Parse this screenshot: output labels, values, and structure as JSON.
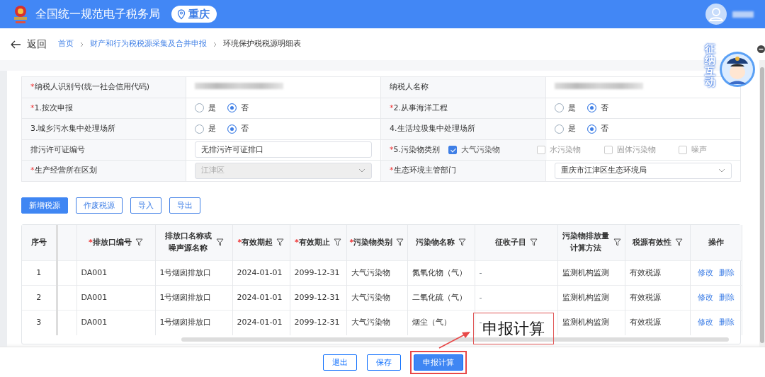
{
  "header": {
    "title": "全国统一规范电子税务局",
    "location": "重庆"
  },
  "nav": {
    "back": "返回",
    "breadcrumbs": [
      {
        "label": "首页",
        "current": false
      },
      {
        "label": "财产和行为税税源采集及合并申报",
        "current": false
      },
      {
        "label": "环境保护税税源明细表",
        "current": true
      }
    ]
  },
  "form": {
    "rows": [
      [
        {
          "kind": "blurred",
          "mark": "*",
          "label": "纳税人识别号(统一社会信用代码)"
        },
        {
          "kind": "blurred",
          "label": "纳税人名称"
        }
      ],
      [
        {
          "kind": "radio",
          "mark": "*",
          "label": "1.按次申报",
          "options": [
            {
              "label": "是",
              "selected": false
            },
            {
              "label": "否",
              "selected": true
            }
          ]
        },
        {
          "kind": "radio",
          "mark": "*",
          "label": "2.从事海洋工程",
          "options": [
            {
              "label": "是",
              "selected": false
            },
            {
              "label": "否",
              "selected": true
            }
          ]
        }
      ],
      [
        {
          "kind": "radio",
          "label": "3.城乡污水集中处理场所",
          "options": [
            {
              "label": "是",
              "selected": false
            },
            {
              "label": "否",
              "selected": true
            }
          ]
        },
        {
          "kind": "radio",
          "label": "4.生活垃圾集中处理场所",
          "options": [
            {
              "label": "是",
              "selected": false
            },
            {
              "label": "否",
              "selected": true
            }
          ]
        }
      ],
      [
        {
          "kind": "input",
          "label": "排污许可证编号",
          "value": "无排污许可证排口"
        },
        {
          "kind": "checks",
          "mark": "*",
          "label": "5.污染物类别",
          "options": [
            {
              "label": "大气污染物",
              "checked": true
            },
            {
              "label": "水污染物",
              "checked": false
            },
            {
              "label": "固体污染物",
              "checked": false
            },
            {
              "label": "噪声",
              "checked": false
            }
          ]
        }
      ],
      [
        {
          "kind": "select",
          "mark": "*",
          "label": "生产经营所在区划",
          "value": "江津区",
          "disabled": true
        },
        {
          "kind": "select",
          "mark": "*",
          "label": "生态环境主管部门",
          "value": "重庆市江津区生态环境局",
          "disabled": false
        }
      ]
    ]
  },
  "toolbar": [
    {
      "label": "新增税源",
      "primary": true
    },
    {
      "label": "作废税源",
      "primary": false
    },
    {
      "label": "导入",
      "primary": false
    },
    {
      "label": "导出",
      "primary": false
    }
  ],
  "table": {
    "columns": [
      {
        "kind": "index",
        "label": "序号",
        "filter": false
      },
      {
        "kind": "blank"
      },
      {
        "kind": "data",
        "mark": "*",
        "label": "排放口编号",
        "filter": true
      },
      {
        "kind": "data",
        "label": "排放口名称或噪声源名称",
        "filter": true
      },
      {
        "kind": "data",
        "mark": "*",
        "label": "有效期起",
        "filter": true
      },
      {
        "kind": "data",
        "mark": "*",
        "label": "有效期止",
        "filter": true
      },
      {
        "kind": "data",
        "mark": "*",
        "label": "污染物类别",
        "filter": true
      },
      {
        "kind": "data",
        "label": "污染物名称",
        "filter": true
      },
      {
        "kind": "data",
        "label": "征收子目",
        "filter": true
      },
      {
        "kind": "data",
        "label": "污染物排放量计算方法",
        "filter": true
      },
      {
        "kind": "data",
        "label": "税源有效性",
        "filter": true
      },
      {
        "kind": "actions",
        "label": "操作",
        "filter": false
      }
    ],
    "rows": [
      {
        "cells": [
          "1",
          "",
          "DA001",
          "1号烟囱排放口",
          "2024-01-01",
          "2099-12-31",
          "大气污染物",
          "氮氧化物（气）",
          "-",
          "监测机构监测",
          "有效税源"
        ],
        "actions": [
          "修改",
          "删除"
        ]
      },
      {
        "cells": [
          "2",
          "",
          "DA001",
          "1号烟囱排放口",
          "2024-01-01",
          "2099-12-31",
          "大气污染物",
          "二氧化硫（气）",
          "-",
          "监测机构监测",
          "有效税源"
        ],
        "actions": [
          "修改",
          "删除"
        ]
      },
      {
        "cells": [
          "3",
          "",
          "DA001",
          "1号烟囱排放口",
          "2024-01-01",
          "2099-12-31",
          "大气污染物",
          "烟尘（气）",
          "-",
          "监测机构监测",
          "有效税源"
        ],
        "actions": [
          "修改",
          "删除"
        ]
      }
    ]
  },
  "footer": [
    {
      "label": "退出",
      "primary": false,
      "highlighted": false
    },
    {
      "label": "保存",
      "primary": false,
      "highlighted": false
    },
    {
      "label": "申报计算",
      "primary": true,
      "highlighted": true
    }
  ],
  "callout": {
    "text": "申报计算"
  },
  "mascot": {
    "text": "征纳互动"
  }
}
